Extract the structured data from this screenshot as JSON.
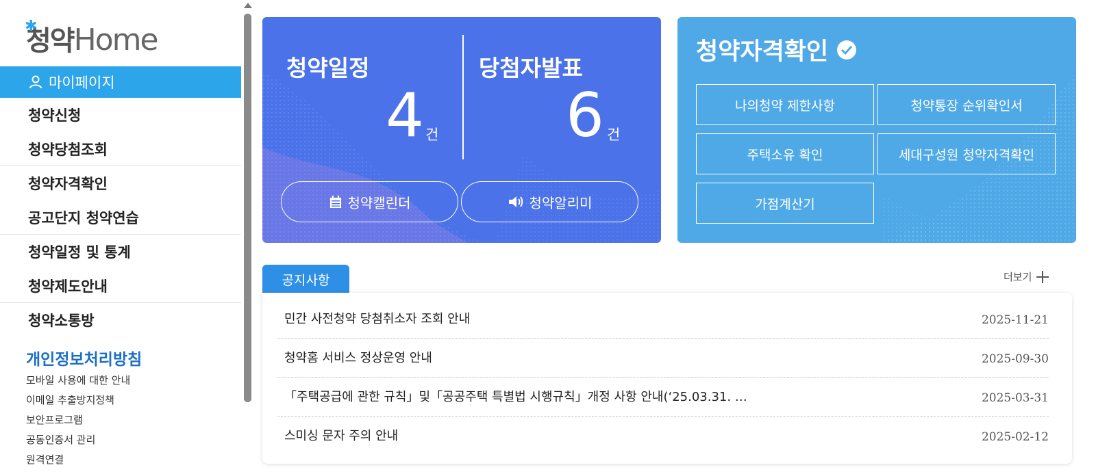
{
  "logo": {
    "text_ko": "청약",
    "text_en": "Home"
  },
  "sidebar": {
    "active_item": "마이페이지",
    "items": [
      {
        "label": "청약신청"
      },
      {
        "label": "청약당첨조회"
      },
      {
        "label": "청약자격확인"
      },
      {
        "label": "공고단지 청약연습"
      },
      {
        "label": "청약일정 및 통계"
      },
      {
        "label": "청약제도안내"
      },
      {
        "label": "청약소통방"
      }
    ],
    "privacy_label": "개인정보처리방침",
    "sub_links": [
      {
        "label": "모바일 사용에 대한 안내"
      },
      {
        "label": "이메일 추출방지정책"
      },
      {
        "label": "보안프로그램"
      },
      {
        "label": "공동인증서 관리"
      },
      {
        "label": "원격연결"
      }
    ]
  },
  "schedule_card": {
    "left_title": "청약일정",
    "left_count": "4",
    "right_title": "당첨자발표",
    "right_count": "6",
    "unit": "건",
    "calendar_button": "청약캘린더",
    "alarm_button": "청약알리미",
    "bg_color": "#4b72e8"
  },
  "eligibility_card": {
    "title": "청약자격확인",
    "buttons": [
      {
        "label": "나의청약 제한사항"
      },
      {
        "label": "청약통장 순위확인서"
      },
      {
        "label": "주택소유 확인"
      },
      {
        "label": "세대구성원 청약자격확인"
      },
      {
        "label": "가점계산기"
      }
    ],
    "bg_color": "#4fa9e6"
  },
  "notice": {
    "tab_label": "공지사항",
    "more_label": "더보기",
    "items": [
      {
        "title": "민간 사전청약 당첨취소자 조회 안내",
        "date": "2025-11-21"
      },
      {
        "title": "청약홈 서비스 정상운영 안내",
        "date": "2025-09-30"
      },
      {
        "title": "「주택공급에 관한 규칙」및「공공주택 특별법 시행규칙」개정 사항 안내(‘25.03.31. …",
        "date": "2025-03-31"
      },
      {
        "title": "스미싱 문자 주의 안내",
        "date": "2025-02-12"
      }
    ]
  },
  "colors": {
    "accent": "#2da5ea",
    "notice_tab": "#2d8fe6",
    "privacy": "#1a6fc8"
  }
}
